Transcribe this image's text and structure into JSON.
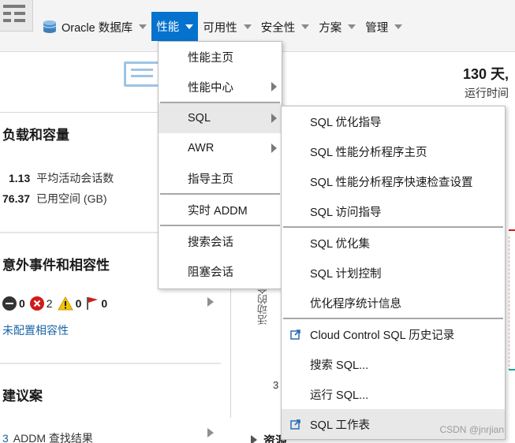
{
  "menubar": {
    "database_label": "Oracle 数据库",
    "performance_label": "性能",
    "availability_label": "可用性",
    "security_label": "安全性",
    "schema_label": "方案",
    "admin_label": "管理"
  },
  "summary": {
    "uptime_value": "130 天,",
    "uptime_label": "运行时间"
  },
  "load": {
    "title": "负载和容量",
    "avg_sessions_value": "1.13",
    "avg_sessions_label": "平均活动会话数",
    "used_space_value": "76.37",
    "used_space_label": "已用空间 (GB)"
  },
  "incidents": {
    "title": "意外事件和相容性",
    "critical_count": "0",
    "error_count": "2",
    "warning_count": "0",
    "flag_count": "0",
    "link": "未配置相容性"
  },
  "advice": {
    "title": "建议案",
    "addm_count": "3",
    "addm_label": "ADDM 查找结果"
  },
  "chart": {
    "axis_label": "活动的会",
    "tick": "3"
  },
  "resources": {
    "label": "资源"
  },
  "perf_menu": {
    "items": [
      {
        "label": "性能主页"
      },
      {
        "label": "性能中心"
      },
      {
        "label": "SQL"
      },
      {
        "label": "AWR"
      },
      {
        "label": "指导主页"
      },
      {
        "label": "实时 ADDM"
      },
      {
        "label": "搜索会话"
      },
      {
        "label": "阻塞会话"
      }
    ]
  },
  "sql_menu": {
    "items": [
      {
        "label": "SQL 优化指导"
      },
      {
        "label": "SQL 性能分析程序主页"
      },
      {
        "label": "SQL 性能分析程序快速检查设置"
      },
      {
        "label": "SQL 访问指导"
      },
      {
        "label": "SQL 优化集"
      },
      {
        "label": "SQL 计划控制"
      },
      {
        "label": "优化程序统计信息"
      },
      {
        "label": "Cloud Control SQL 历史记录"
      },
      {
        "label": "搜索 SQL..."
      },
      {
        "label": "运行 SQL..."
      },
      {
        "label": "SQL 工作表"
      }
    ]
  },
  "watermark": "CSDN @jnrjian",
  "colors": {
    "accent": "#0572ce",
    "critical": "#333333",
    "error": "#d11a1a",
    "warning": "#f5c400",
    "flag": "#d11a1a",
    "link": "#1a64a8"
  }
}
